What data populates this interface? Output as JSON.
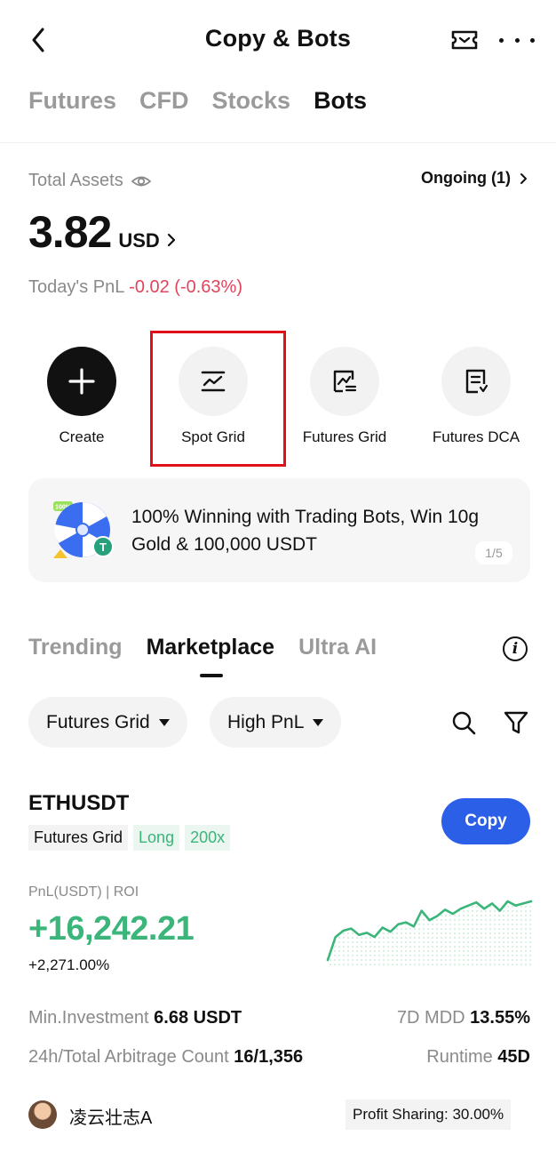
{
  "header": {
    "title": "Copy & Bots"
  },
  "top_tabs": [
    {
      "label": "Futures",
      "active": false
    },
    {
      "label": "CFD",
      "active": false
    },
    {
      "label": "Stocks",
      "active": false
    },
    {
      "label": "Bots",
      "active": true
    }
  ],
  "assets": {
    "label": "Total Assets",
    "value": "3.82",
    "currency": "USD",
    "ongoing": "Ongoing (1)",
    "pnl_label": "Today's PnL",
    "pnl_value": "-0.02 (-0.63%)"
  },
  "bots": [
    {
      "label": "Create",
      "icon": "plus-icon"
    },
    {
      "label": "Spot Grid",
      "icon": "spot-grid-icon"
    },
    {
      "label": "Futures Grid",
      "icon": "futures-grid-icon"
    },
    {
      "label": "Futures DCA",
      "icon": "futures-dca-icon"
    }
  ],
  "banner": {
    "text": "100% Winning with Trading Bots, Win 10g Gold & 100,000 USDT",
    "badge": "100%",
    "pager": "1/5"
  },
  "sub_tabs": [
    {
      "label": "Trending",
      "active": false
    },
    {
      "label": "Marketplace",
      "active": true
    },
    {
      "label": "Ultra AI",
      "active": false
    }
  ],
  "filters": {
    "type": "Futures Grid",
    "sort": "High PnL"
  },
  "card": {
    "pair": "ETHUSDT",
    "tags": [
      "Futures Grid",
      "Long",
      "200x"
    ],
    "copy_label": "Copy",
    "pnl_label": "PnL(USDT) | ROI",
    "pnl_value": "+16,242.21",
    "roi": "+2,271.00%",
    "min_investment_label": "Min.Investment",
    "min_investment_value": "6.68 USDT",
    "mdd_label": "7D MDD",
    "mdd_value": "13.55%",
    "arb_label": "24h/Total Arbitrage Count",
    "arb_value": "16/1,356",
    "runtime_label": "Runtime",
    "runtime_value": "45D",
    "username": "凌云壮志A",
    "profit_sharing": "Profit Sharing: 30.00%",
    "sparkline": [
      8,
      30,
      36,
      38,
      32,
      34,
      30,
      39,
      35,
      42,
      44,
      40,
      55,
      46,
      50,
      56,
      52,
      57,
      60,
      63,
      57,
      62,
      55,
      64,
      60,
      62,
      64
    ]
  },
  "colors": {
    "accent_blue": "#2b5fe8",
    "profit_green": "#3bb57a",
    "loss_red": "#e0455c",
    "highlight_red": "#e0101a"
  }
}
